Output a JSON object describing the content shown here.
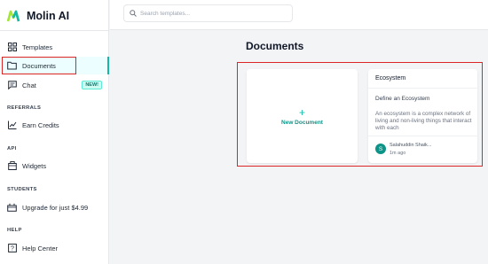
{
  "brand": {
    "name": "Molin AI",
    "accent": "#14b8a6"
  },
  "search": {
    "placeholder": "Search templates..."
  },
  "sidebar": {
    "items": [
      {
        "label": "Templates",
        "icon": "templates-icon"
      },
      {
        "label": "Documents",
        "icon": "folder-icon",
        "active": true
      },
      {
        "label": "Chat",
        "icon": "chat-icon",
        "badge": "NEW!"
      },
      {
        "label": "Earn Credits",
        "icon": "chart-icon"
      },
      {
        "label": "Widgets",
        "icon": "widget-icon"
      },
      {
        "label": "Upgrade for just $4.99",
        "icon": "gift-icon"
      },
      {
        "label": "Help Center",
        "icon": "help-icon"
      }
    ],
    "sections": {
      "referrals": "REFERRALS",
      "api": "API",
      "students": "STUDENTS",
      "help": "HELP"
    }
  },
  "main": {
    "title": "Documents",
    "new_document": {
      "plus": "+",
      "label": "New Document"
    },
    "documents": [
      {
        "title": "Ecosystem",
        "heading": "Define an Ecosystem",
        "excerpt": "An ecosystem is a complex network of living and non-living things that interact with each",
        "avatar": "S",
        "author": "Salahuddin Shaik...",
        "time": "1m ago"
      }
    ]
  }
}
